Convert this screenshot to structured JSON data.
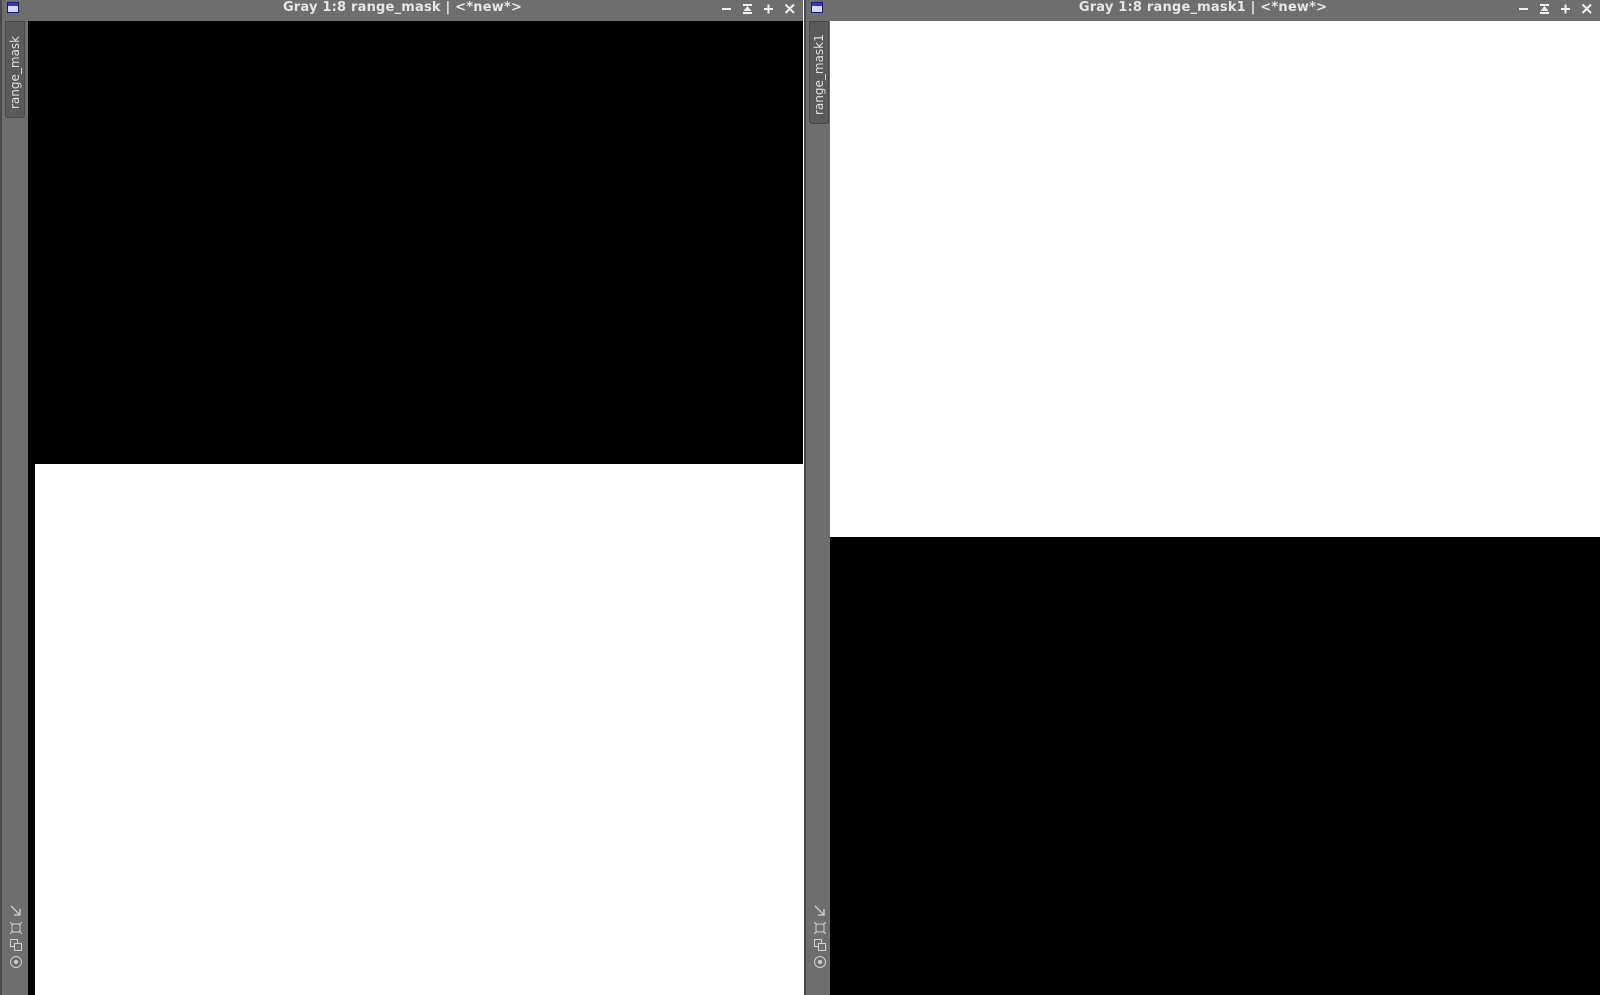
{
  "windows": [
    {
      "title": "Gray 1:8 range_mask | <*new*>",
      "tab_label": "range_mask",
      "image": {
        "upper_color": "#000000",
        "lower_color": "#ffffff"
      }
    },
    {
      "title": "Gray 1:8 range_mask1 | <*new*>",
      "tab_label": "range_mask1",
      "image": {
        "upper_color": "#ffffff",
        "lower_color": "#000000"
      }
    }
  ],
  "icons": {
    "window": "window-icon",
    "minimize": "minimize-icon",
    "shade": "shade-icon",
    "maximize": "maximize-icon",
    "close": "close-icon",
    "tools": [
      "fit-view-icon",
      "zoom-fit-icon",
      "clone-icon",
      "target-icon"
    ]
  },
  "colors": {
    "chrome": "#6e6e6e",
    "title_text": "#e6e6e6"
  }
}
